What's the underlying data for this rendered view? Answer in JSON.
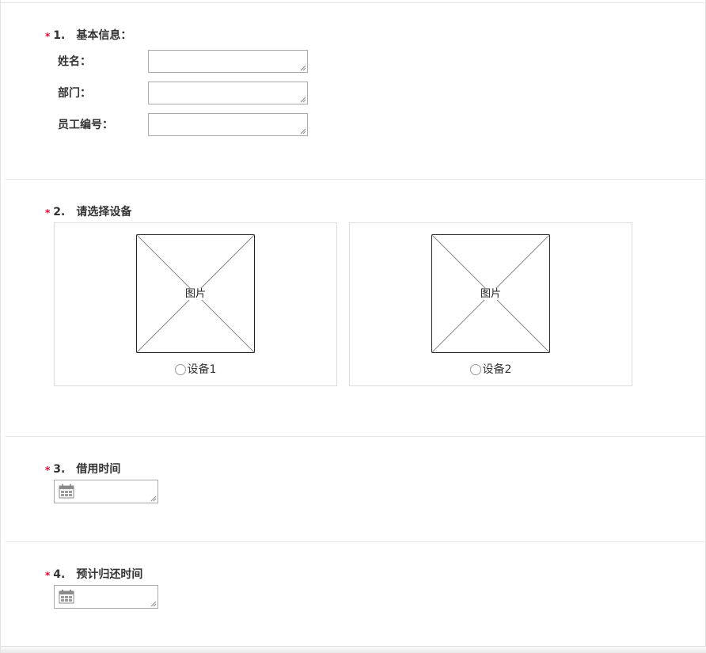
{
  "questions": [
    {
      "required_mark": "*",
      "number": "1.",
      "title": "基本信息：",
      "fields": [
        {
          "label": "姓名：",
          "value": ""
        },
        {
          "label": "部门：",
          "value": ""
        },
        {
          "label": "员工编号：",
          "value": ""
        }
      ]
    },
    {
      "required_mark": "*",
      "number": "2.",
      "title": "请选择设备",
      "options": [
        {
          "image_caption": "图片",
          "label": "设备1",
          "selected": false
        },
        {
          "image_caption": "图片",
          "label": "设备2",
          "selected": false
        }
      ]
    },
    {
      "required_mark": "*",
      "number": "3.",
      "title": "借用时间",
      "date_value": "",
      "icon": "calendar-icon"
    },
    {
      "required_mark": "*",
      "number": "4.",
      "title": "预计归还时间",
      "date_value": "",
      "icon": "calendar-icon"
    }
  ],
  "colors": {
    "required": "#e4002b",
    "text": "#333333",
    "border": "#a9a9a9",
    "divider": "#e6e6e6"
  }
}
